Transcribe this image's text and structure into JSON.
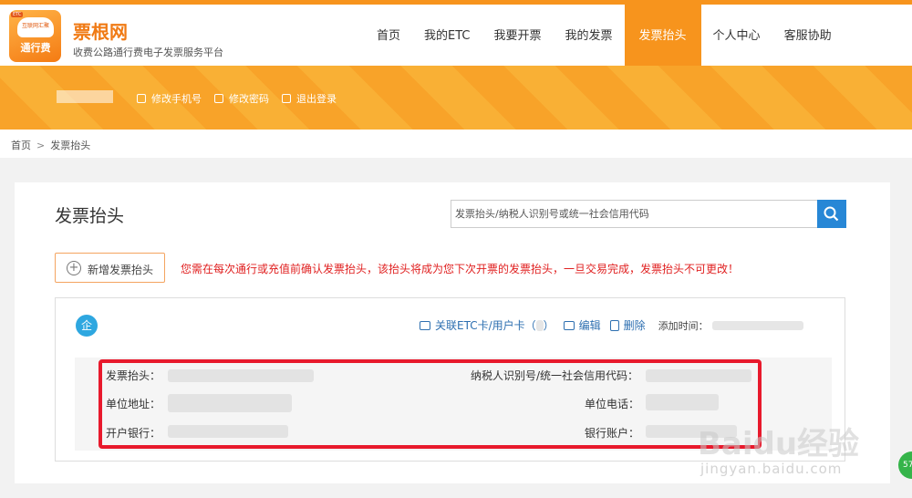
{
  "header": {
    "logo_tag": "ETC",
    "logo_cloud_text": "互联网汇聚",
    "logo_text": "通行费",
    "brand_name": "票根网",
    "brand_subtitle": "收费公路通行费电子发票服务平台"
  },
  "nav": {
    "items": [
      "首页",
      "我的ETC",
      "我要开票",
      "我的发票",
      "发票抬头",
      "个人中心",
      "客服协助"
    ],
    "active": "发票抬头"
  },
  "banner": {
    "change_phone": "修改手机号",
    "change_password": "修改密码",
    "logout": "退出登录"
  },
  "breadcrumb": {
    "home": "首页",
    "separator": ">",
    "current": "发票抬头"
  },
  "page": {
    "title": "发票抬头",
    "search_placeholder": "发票抬头/纳税人识别号或统一社会信用代码",
    "add_button": "新增发票抬头",
    "warning": "您需在每次通行或充值前确认发票抬头，该抬头将成为您下次开票的发票抬头，一旦交易完成，发票抬头不可更改！"
  },
  "invoice_item": {
    "type_badge": "企",
    "link_card": "关联ETC卡/用户卡（",
    "link_card_close": "）",
    "edit": "编辑",
    "delete": "删除",
    "added_time_label": "添加时间：",
    "fields": {
      "title_label": "发票抬头：",
      "tax_id_label": "纳税人识别号/统一社会信用代码：",
      "address_label": "单位地址：",
      "phone_label": "单位电话：",
      "bank_label": "开户银行：",
      "account_label": "银行账户："
    }
  },
  "watermark": {
    "logo": "Baidu经验",
    "url": "jingyan.baidu.com",
    "badge": "57"
  },
  "colors": {
    "brand_orange": "#f7941d",
    "link_blue": "#2d6fb0",
    "warning_red": "#e02020",
    "highlight_red": "#e8192c",
    "search_blue": "#2787d6"
  }
}
